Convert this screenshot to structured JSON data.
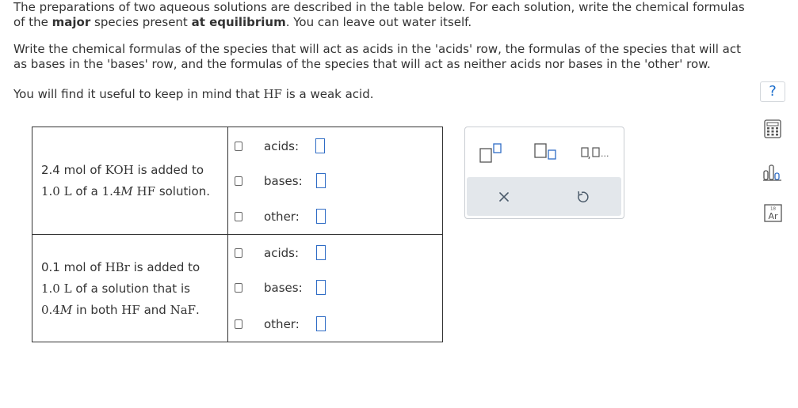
{
  "intro": {
    "line1": "The preparations of two aqueous solutions are described in the table below. For each solution, write the chemical formulas",
    "line2_pre": "of the ",
    "line2_bold1": "major",
    "line2_mid": " species present ",
    "line2_bold2": "at equilibrium",
    "line2_post": ". You can leave out water itself."
  },
  "instructions": {
    "line1": "Write the chemical formulas of the species that will act as acids in the 'acids' row, the formulas of the species that will act",
    "line2": "as bases in the 'bases' row, and the formulas of the species that will act as neither acids nor bases in the 'other' row."
  },
  "hint": {
    "pre": "You will find it useful to keep in mind that ",
    "formula": "HF",
    "post": " is a weak acid."
  },
  "help_label": "?",
  "rows": [
    {
      "desc": {
        "a1": "2.4 mol of ",
        "a2": "KOH",
        "a3": " is added to",
        "b1": "1.0 L",
        "b2": " of a ",
        "b3": "1.4",
        "b4": "M",
        "b5": " HF",
        "b6": " solution."
      },
      "labels": {
        "acids": "acids:",
        "bases": "bases:",
        "other": "other:"
      }
    },
    {
      "desc": {
        "a1": "0.1 mol of ",
        "a2": "HBr",
        "a3": " is added to",
        "b1": "1.0 L",
        "b2": " of a solution that is",
        "c1": "0.4",
        "c2": "M",
        "c3": " in both ",
        "c4": "HF",
        "c5": " and ",
        "c6": "NaF",
        "c7": "."
      },
      "labels": {
        "acids": "acids:",
        "bases": "bases:",
        "other": "other:"
      }
    }
  ],
  "palette": {
    "tools": [
      "superscript-tool",
      "subscript-tool",
      "list-tool"
    ],
    "list_ellipsis": "...",
    "actions": [
      "clear",
      "undo"
    ]
  },
  "side_tools": {
    "periodic_number": "18",
    "periodic_symbol": "Ar"
  },
  "colors": {
    "accent": "#2f6cc5",
    "help": "#1a6dcc",
    "palette_actions_bg": "#e3e7eb"
  }
}
